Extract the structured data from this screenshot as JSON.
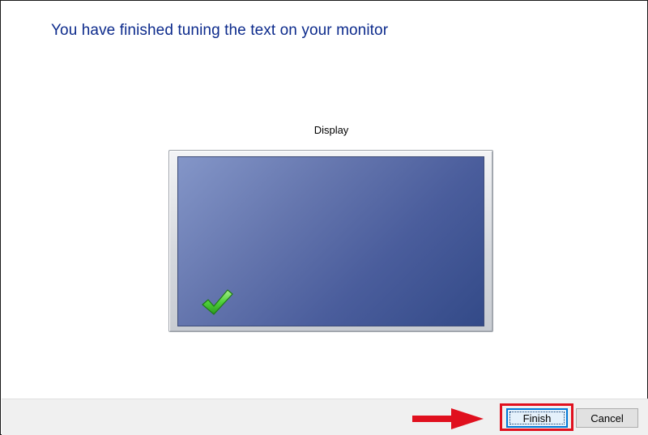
{
  "heading": "You have finished tuning the text on your monitor",
  "monitor": {
    "label": "Display",
    "status_icon": "checkmark-icon"
  },
  "buttons": {
    "finish_label": "Finish",
    "cancel_label": "Cancel"
  },
  "annotations": {
    "arrow_icon": "red-arrow-icon",
    "highlight_color": "#e0101e"
  },
  "colors": {
    "heading": "#0d2b8c",
    "screen": "#4a5d9c",
    "check": "#3cbf2a",
    "accent": "#0078d7"
  }
}
